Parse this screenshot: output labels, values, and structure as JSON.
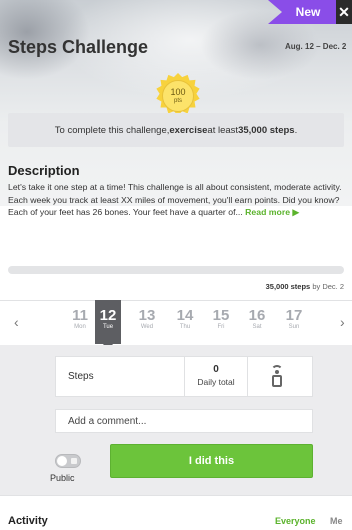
{
  "header": {
    "badge": "New",
    "close_glyph": "✕",
    "title": "Steps Challenge",
    "dates": "Aug. 12 – Dec. 2",
    "points_value": "100",
    "points_unit": "pts"
  },
  "goal": {
    "prefix": "To complete this challenge, ",
    "action": "exercise",
    "middle": " at least ",
    "target": "35,000 steps",
    "suffix": "."
  },
  "description": {
    "title": "Description",
    "text": "Let's take it one step at a time! This challenge is all about consistent, moderate activity. Each week you track at least XX miles of movement, you'll earn points. Did you know? Each of your feet has 26 bones. Your feet have a quarter of... ",
    "read_more": "Read more ▶"
  },
  "progress": {
    "fraction": 0,
    "target_steps": "35,000 steps",
    "target_suffix": " by Dec. 2"
  },
  "calendar": {
    "prev_glyph": "‹",
    "next_glyph": "›",
    "selected_index": 1,
    "days": [
      {
        "num": "11",
        "weekday": "Mon"
      },
      {
        "num": "12",
        "weekday": "Tue"
      },
      {
        "num": "13",
        "weekday": "Wed"
      },
      {
        "num": "14",
        "weekday": "Thu"
      },
      {
        "num": "15",
        "weekday": "Fri"
      },
      {
        "num": "16",
        "weekday": "Sat"
      },
      {
        "num": "17",
        "weekday": "Sun"
      }
    ]
  },
  "tracker": {
    "steps_label": "Steps",
    "daily_value": "0",
    "daily_label": "Daily total",
    "device_icon": "device-sync-icon",
    "comment_placeholder": "Add a comment...",
    "public_label": "Public",
    "public_on": false,
    "submit_label": "I did this"
  },
  "activity": {
    "title": "Activity",
    "filter_everyone": "Everyone",
    "filter_me": "Me"
  },
  "colors": {
    "accent_green": "#6cc43b",
    "badge_purple": "#8a4de8",
    "selected_day": "#5d5e62"
  }
}
